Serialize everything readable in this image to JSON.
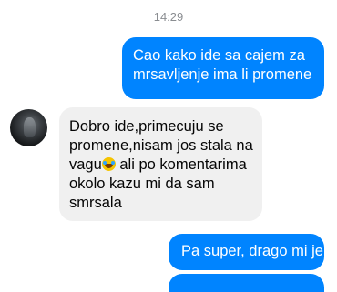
{
  "conversation": {
    "timestamp": "14:29",
    "messages": [
      {
        "direction": "outgoing",
        "lines": [
          "Cao kako ide sa cajem za",
          "mrsavljenje ima li promene"
        ]
      },
      {
        "direction": "incoming",
        "sender_avatar": "contact-avatar",
        "lines": [
          "Dobro ide,primecuju se",
          "promene,nisam jos stala na",
          "vagu",
          " ali po komentarima",
          "okolo kazu mi da sam",
          "smrsala"
        ],
        "emoji": "face-with-tears-of-joy-icon"
      },
      {
        "direction": "outgoing",
        "lines": [
          "Pa super, drago mi je"
        ]
      }
    ]
  },
  "colors": {
    "outgoing_bubble": "#0084ff",
    "incoming_bubble": "#f0f0f0",
    "timestamp_text": "#8a8d91"
  }
}
